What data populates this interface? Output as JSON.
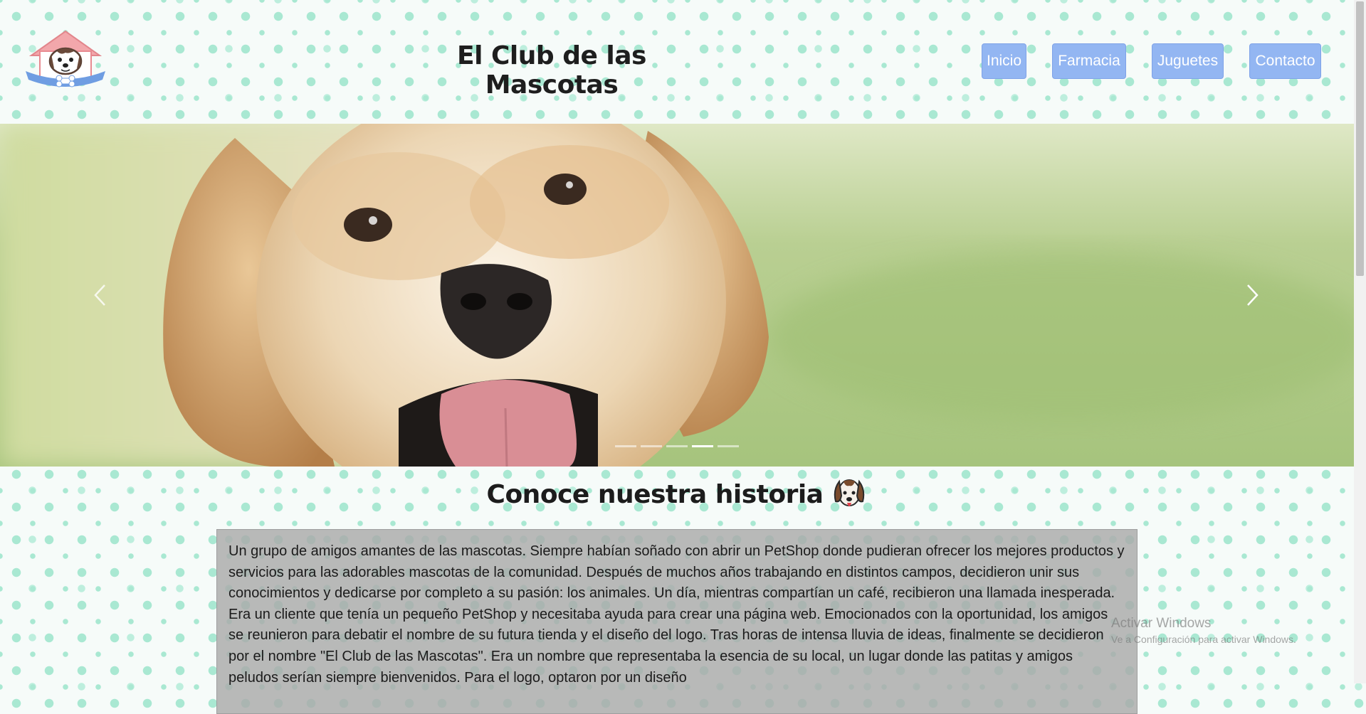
{
  "header": {
    "site_title": "El Club de las Mascotas",
    "nav": [
      "Inicio",
      "Farmacia",
      "Juguetes",
      "Contacto"
    ]
  },
  "carousel": {
    "prev_icon": "chevron-left-icon",
    "next_icon": "chevron-right-icon",
    "slide_count": 5,
    "active_slide": 4
  },
  "story": {
    "heading": "Conoce nuestra historia",
    "heading_icon": "dog-face-icon",
    "text": "Un grupo de amigos amantes de las mascotas. Siempre habían soñado con abrir un PetShop donde pudieran ofrecer los mejores productos y servicios para las adorables mascotas de la comunidad. Después de muchos años trabajando en distintos campos, decidieron unir sus conocimientos y dedicarse por completo a su pasión: los animales. Un día, mientras compartían un café, recibieron una llamada inesperada. Era un cliente que tenía un pequeño PetShop y necesitaba ayuda para crear una página web. Emocionados con la oportunidad, los amigos se reunieron para debatir el nombre de su futura tienda y el diseño del logo. Tras horas de intensa lluvia de ideas, finalmente se decidieron por el nombre \"El Club de las Mascotas\". Era un nombre que representaba la esencia de su local, un lugar donde las patitas y amigos peludos serían siempre bienvenidos. Para el logo, optaron por un diseño"
  },
  "watermark": {
    "line1": "Activar Windows",
    "line2": "Ve a Configuración para activar Windows."
  },
  "colors": {
    "nav_button": "#93b6f2",
    "dots": "#a9e8d2",
    "story_box": "#aaaaaa"
  }
}
